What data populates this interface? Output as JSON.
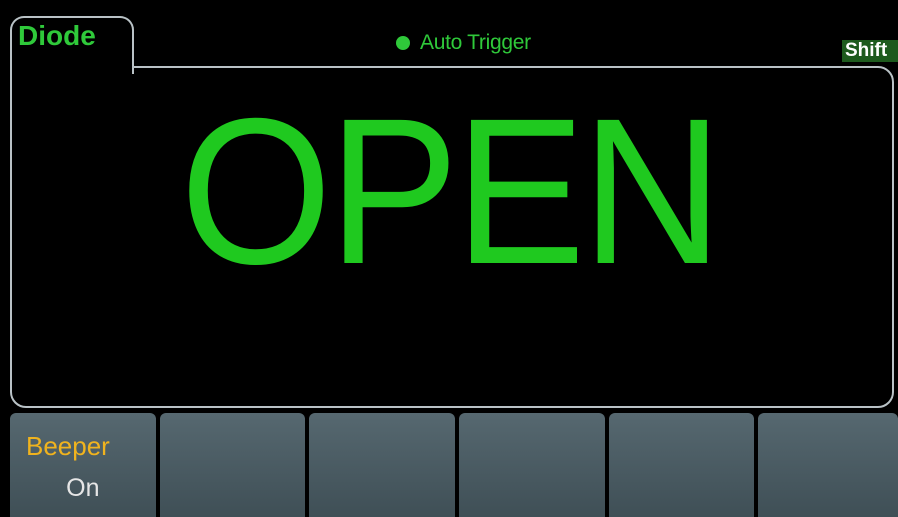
{
  "header": {
    "mode": "Diode",
    "trigger_status": "Auto Trigger",
    "shift_indicator": "Shift"
  },
  "display": {
    "reading": "OPEN"
  },
  "softkeys": [
    {
      "title": "Beeper",
      "value": "On"
    },
    {
      "title": "",
      "value": ""
    },
    {
      "title": "",
      "value": ""
    },
    {
      "title": "",
      "value": ""
    },
    {
      "title": "",
      "value": ""
    },
    {
      "title": "",
      "value": ""
    }
  ],
  "colors": {
    "reading": "#1fc91f",
    "label_green": "#2fc93a",
    "softkey_title": "#f0b31e",
    "softkey_bg": "#4a5b62",
    "frame": "#b9c2c6"
  }
}
